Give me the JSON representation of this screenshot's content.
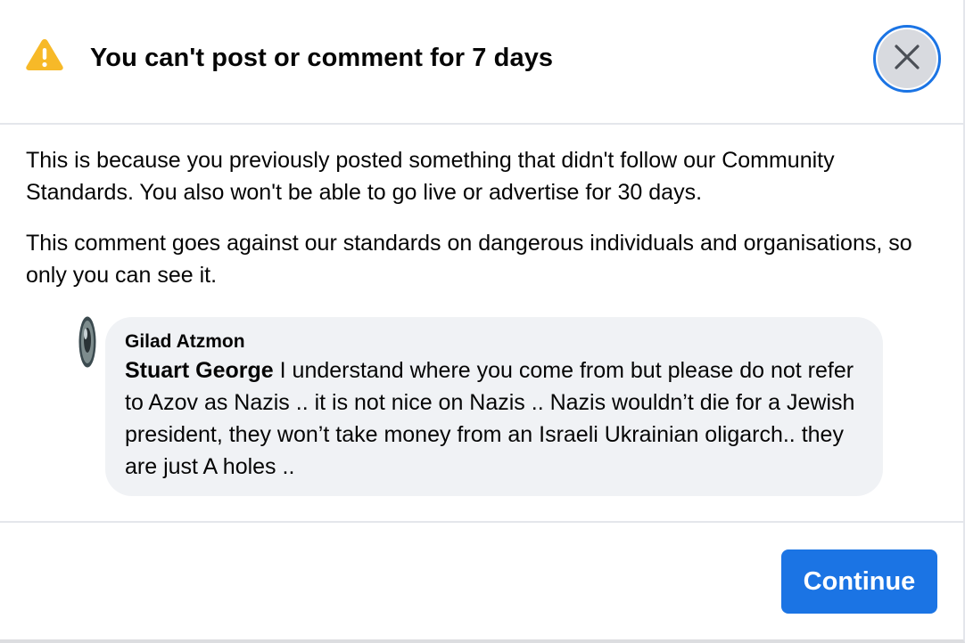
{
  "dialog": {
    "title": "You can't post or comment for 7 days",
    "close_icon": "close-icon",
    "warning_icon": "warning-icon"
  },
  "body": {
    "paragraph1": "This is because you previously posted something that didn't follow our Community Standards. You also won't be able to go live or advertise for 30 days.",
    "paragraph2": "This comment goes against our standards on dangerous individuals and organisations, so only you can see it."
  },
  "comment": {
    "author": "Gilad Atzmon",
    "mention": "Stuart George",
    "text": " I understand where you come from but please do not refer to Azov as Nazis .. it is not nice on Nazis .. Nazis wouldn’t die for a Jewish president, they won’t take money from an Israeli Ukrainian oligarch.. they are just A holes .."
  },
  "footer": {
    "continue_label": "Continue"
  },
  "colors": {
    "accent": "#1b74e4",
    "warning": "#f7b928",
    "bubble": "#f0f2f5"
  }
}
